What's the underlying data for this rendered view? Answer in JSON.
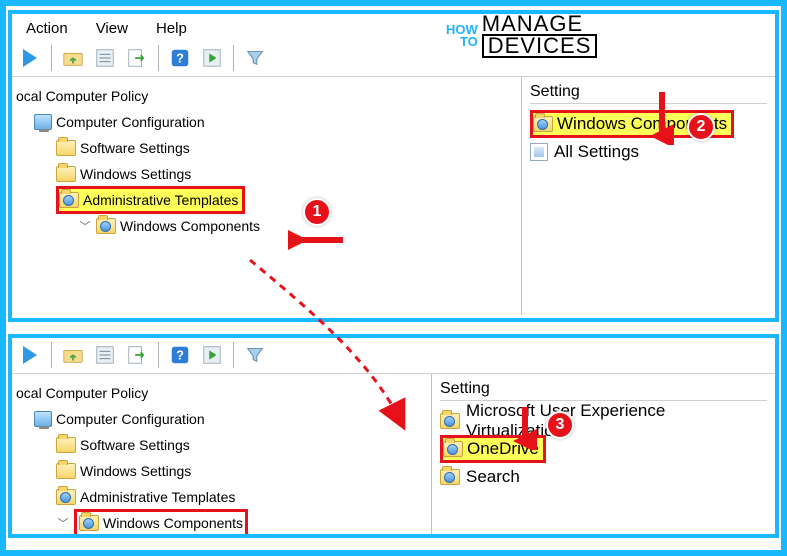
{
  "menu": {
    "action": "Action",
    "view": "View",
    "help": "Help"
  },
  "logo": {
    "how": "HOW",
    "to": "TO",
    "manage": "MANAGE",
    "devices": "DEVICES"
  },
  "badges": {
    "one": "1",
    "two": "2",
    "three": "3"
  },
  "top": {
    "tree": {
      "root": "ocal Computer Policy",
      "comp_config": "Computer Configuration",
      "software": "Software Settings",
      "windows_settings": "Windows Settings",
      "admin_templates": "Administrative Templates",
      "win_components": "Windows Components"
    },
    "list": {
      "header": "Setting",
      "win_components": "Windows Components",
      "all_settings": "All Settings"
    }
  },
  "bottom": {
    "tree": {
      "root": "ocal Computer Policy",
      "comp_config": "Computer Configuration",
      "software": "Software Settings",
      "windows_settings": "Windows Settings",
      "admin_templates": "Administrative Templates",
      "win_components": "Windows Components"
    },
    "list": {
      "header": "Setting",
      "ms_uev": "Microsoft User Experience Virtualization",
      "onedrive": "OneDrive",
      "search": "Search"
    }
  }
}
